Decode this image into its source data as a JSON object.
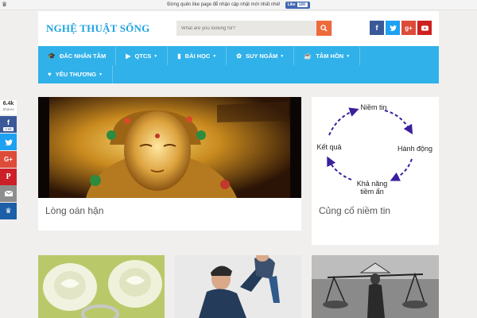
{
  "notice": {
    "text": "Đừng quên like page để nhận cập nhật mới nhất nhé!",
    "like_label": "Like",
    "like_count": "16K"
  },
  "header": {
    "logo": "NGHỆ THUẬT SỐNG",
    "search_placeholder": "What are you looking for?"
  },
  "social_icons": [
    "facebook-icon",
    "twitter-icon",
    "google-plus-icon",
    "youtube-icon"
  ],
  "nav": {
    "items": [
      {
        "label": "ĐẮC NHÂN TÂM",
        "icon": "graduation-cap-icon",
        "has_dropdown": false
      },
      {
        "label": "QTCS",
        "icon": "video-icon",
        "has_dropdown": true
      },
      {
        "label": "BÀI HỌC",
        "icon": "book-icon",
        "has_dropdown": true
      },
      {
        "label": "SUY NGẪM",
        "icon": "brain-icon",
        "has_dropdown": true
      },
      {
        "label": "TÂM HỒN",
        "icon": "coffee-icon",
        "has_dropdown": true
      },
      {
        "label": "YÊU THƯƠNG",
        "icon": "heart-icon",
        "has_dropdown": true
      }
    ]
  },
  "share": {
    "count": "6.4k",
    "count_label": "Shares",
    "fb_count": "3.8k"
  },
  "cards": [
    {
      "title": "Lòng oán hận"
    },
    {
      "title": "Củng cố niềm tin"
    }
  ],
  "diagram": {
    "nodes": [
      "Niềm tin",
      "Hành động",
      "Khả năng\ntiềm ẩn",
      "Kết quả"
    ],
    "node_lines": {
      "bottom_1": "Khả năng",
      "bottom_2": "tiềm ẩn"
    }
  },
  "colors": {
    "brand": "#1fa2e0",
    "nav": "#30b1e9",
    "search_button": "#ee6a3b",
    "diagram_arrow": "#3b1f9e"
  }
}
